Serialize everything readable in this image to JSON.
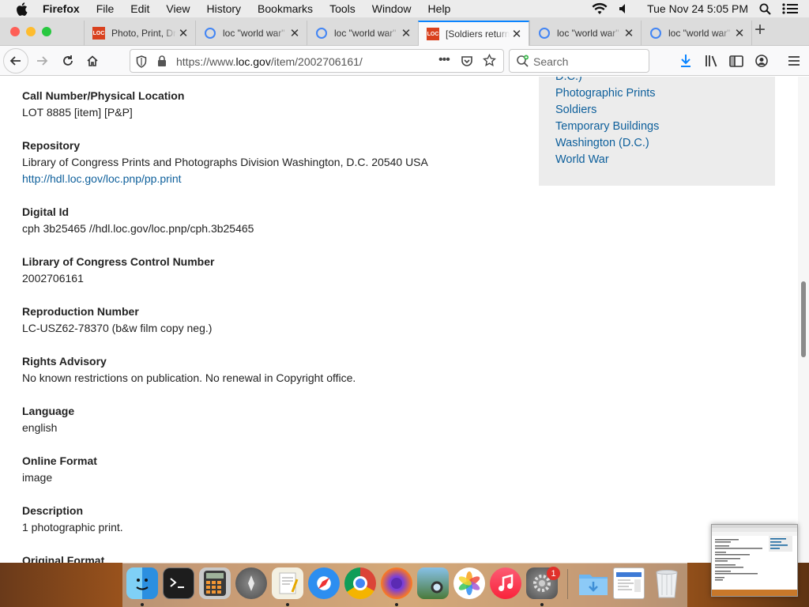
{
  "menubar": {
    "items": [
      "Firefox",
      "File",
      "Edit",
      "View",
      "History",
      "Bookmarks",
      "Tools",
      "Window",
      "Help"
    ],
    "clock": "Tue Nov 24  5:05 PM",
    "icons": [
      "apple-icon",
      "wifi-icon",
      "volume-icon",
      "spotlight-search-icon",
      "control-center-icon"
    ]
  },
  "tabs": [
    {
      "title": "Photo, Print, Drawing",
      "favicon": "loc-logo",
      "active": false
    },
    {
      "title": "loc \"world war\"",
      "favicon": "google-g",
      "active": false
    },
    {
      "title": "loc \"world war\"",
      "favicon": "google-g",
      "active": false
    },
    {
      "title": "[Soldiers returning",
      "favicon": "loc-logo",
      "active": true
    },
    {
      "title": "loc \"world war\"",
      "favicon": "google-g",
      "active": false
    },
    {
      "title": "loc \"world war\"",
      "favicon": "google-g",
      "active": false
    }
  ],
  "newtab_label": "+",
  "close_glyph": "✕",
  "favicon_loc_text": "LOC",
  "favicon_google_text": "G",
  "nav": {
    "url_prefix": "https://www.",
    "url_host": "loc.gov",
    "url_path": "/item/2002706161/",
    "search_placeholder": "Search",
    "page_actions": "•••"
  },
  "record_fields": [
    {
      "label": "Call Number/Physical Location",
      "values": [
        "LOT 8885 [item] [P&P]"
      ]
    },
    {
      "label": "Repository",
      "values": [
        "Library of Congress Prints and Photographs Division Washington, D.C. 20540 USA"
      ],
      "link": "http://hdl.loc.gov/loc.pnp/pp.print"
    },
    {
      "label": "Digital Id",
      "values": [
        "cph 3b25465 //hdl.loc.gov/loc.pnp/cph.3b25465"
      ]
    },
    {
      "label": "Library of Congress Control Number",
      "values": [
        "2002706161"
      ]
    },
    {
      "label": "Reproduction Number",
      "values": [
        "LC-USZ62-78370 (b&w film copy neg.)"
      ]
    },
    {
      "label": "Rights Advisory",
      "values": [
        "No known restrictions on publication. No renewal in Copyright office."
      ]
    },
    {
      "label": "Language",
      "values": [
        "english"
      ]
    },
    {
      "label": "Online Format",
      "values": [
        "image"
      ]
    },
    {
      "label": "Description",
      "values": [
        "1 photographic print."
      ]
    },
    {
      "label": "Original Format",
      "values": []
    }
  ],
  "subjects_partial": [
    "D.C.)",
    "Photographic Prints",
    "Soldiers",
    "Temporary Buildings",
    "Washington (D.C.)",
    "World War"
  ],
  "dock": {
    "apps": [
      "finder",
      "terminal",
      "calculator",
      "launchpad",
      "textedit",
      "safari",
      "chrome",
      "firefox",
      "preview",
      "photos",
      "music",
      "system-preferences",
      "downloads-folder",
      "screenshot-doc",
      "trash"
    ],
    "system_preferences_badge": "1"
  },
  "colors": {
    "link": "#0d5f9b",
    "active_tab_accent": "#0a84ff",
    "sidebar_bg": "#ececec",
    "badge": "#e0302a"
  }
}
